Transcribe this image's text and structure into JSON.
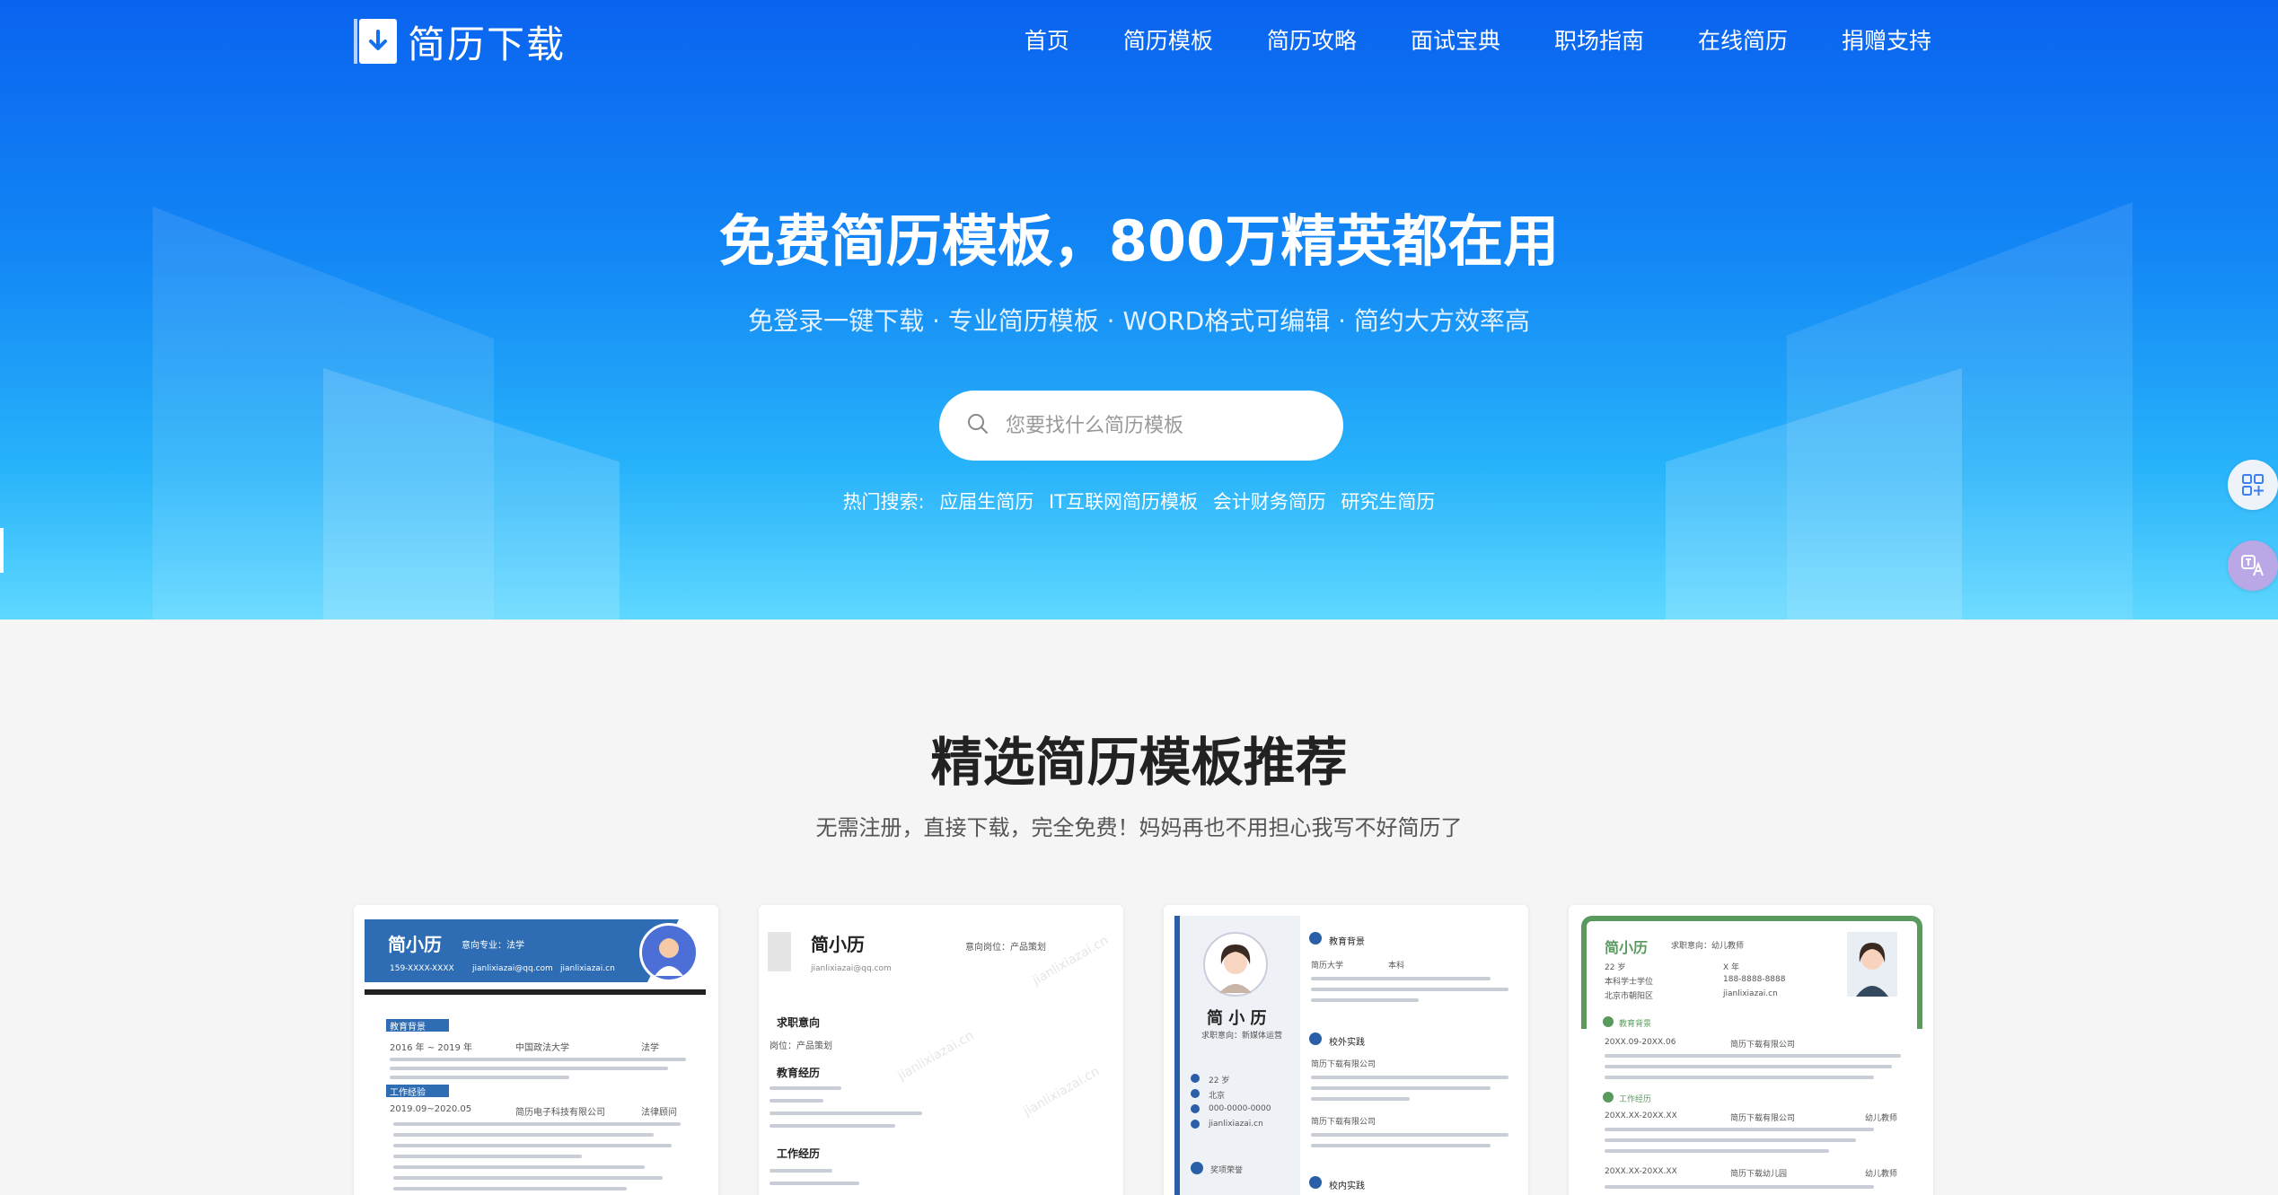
{
  "brand": {
    "name": "简历下载"
  },
  "nav": [
    "首页",
    "简历模板",
    "简历攻略",
    "面试宝典",
    "职场指南",
    "在线简历",
    "捐赠支持"
  ],
  "hero": {
    "title": "免费简历模板，800万精英都在用",
    "subtitle": "免登录一键下载 · 专业简历模板 · WORD格式可编辑 · 简约大方效率高",
    "search_placeholder": "您要找什么简历模板",
    "hot_label": "热门搜索:",
    "hot_links": [
      "应届生简历",
      "IT互联网简历模板",
      "会计财务简历",
      "研究生简历"
    ]
  },
  "section": {
    "title": "精选简历模板推荐",
    "subtitle": "无需注册，直接下载，完全免费！妈妈再也不用担心我写不好简历了"
  },
  "cards": [
    {
      "name": "简小历",
      "intent": "意向专业：法学",
      "phone": "159-XXXX-XXXX",
      "email": "jianlixiazai@qq.com",
      "site": "jianlixiazai.cn",
      "sections": [
        "教育背景",
        "工作经验"
      ],
      "edu_line": "2016 年 ~ 2019 年",
      "school": "中国政法大学",
      "major": "法学",
      "work_line": "2019.09~2020.05",
      "company": "简历电子科技有限公司",
      "role": "法律顾问",
      "accent": "#2e6db4"
    },
    {
      "name": "简小历",
      "intent": "意向岗位：产品策划",
      "email": "jianlixiazai@qq.com",
      "sections": [
        "求职意向",
        "教育经历",
        "工作经历"
      ],
      "job": "岗位：产品策划",
      "watermark": "jianlixiazai.cn",
      "accent": "#333333"
    },
    {
      "name": "简 小 历",
      "intent": "求职意向：新媒体运营",
      "age": "22 岁",
      "city": "北京",
      "phone": "000-0000-0000",
      "site": "jianlixiazai.cn",
      "sections": [
        "教育背景",
        "校外实践",
        "奖项荣誉",
        "校内实践"
      ],
      "school": "简历大学",
      "degree": "本科",
      "company": "简历下载有限公司",
      "accent": "#2a5fa8"
    },
    {
      "name": "简小历",
      "intent": "求职意向：幼儿教师",
      "age": "22 岁",
      "edu": "本科学士学位",
      "years": "X 年",
      "phone": "188-8888-8888",
      "address": "北京市朝阳区",
      "email": "jianlixiazai.cn",
      "sections": [
        "教育背景",
        "工作经历"
      ],
      "date1": "20XX.09-20XX.06",
      "date2": "20XX.XX-20XX.XX",
      "company": "简历下载有限公司",
      "role": "幼儿教师",
      "kg": "简历下载幼儿园",
      "accent": "#5b9a5f"
    }
  ]
}
